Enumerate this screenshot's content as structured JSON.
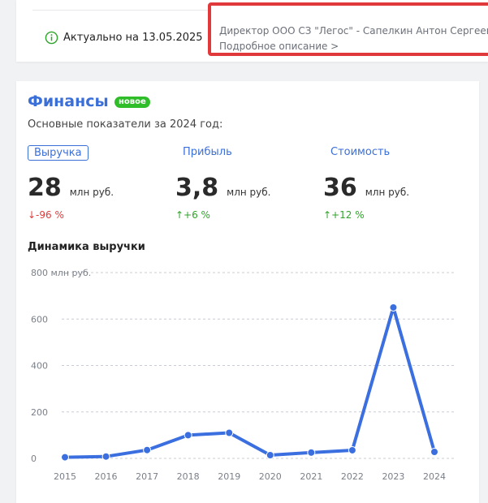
{
  "status": {
    "actual_label": "Актуально на 13.05.2025"
  },
  "director": {
    "text": "Директор ООО СЗ \"Легос\" - Сапелкин Антон Сергеевич (И",
    "link": "Подробное описание >"
  },
  "finance": {
    "title": "Финансы",
    "badge": "новое",
    "subtitle": "Основные показатели за 2024 год:",
    "metrics": [
      {
        "label": "Выручка",
        "value": "28",
        "unit": "млн руб.",
        "change": "↓-96 %",
        "direction": "down",
        "active": true
      },
      {
        "label": "Прибыль",
        "value": "3,8",
        "unit": "млн руб.",
        "change": "↑+6 %",
        "direction": "up",
        "active": false
      },
      {
        "label": "Стоимость",
        "value": "36",
        "unit": "млн руб.",
        "change": "↑+12 %",
        "direction": "up",
        "active": false
      }
    ],
    "chart_title": "Динамика выручки"
  },
  "colors": {
    "accent": "#3b6fd8",
    "line": "#3b6fe0",
    "down": "#e23b3b",
    "up": "#2fa52a",
    "highlight_border": "#e0383b",
    "badge": "#2fbd2a"
  },
  "chart_data": {
    "type": "line",
    "title": "Динамика выручки",
    "ylabel": "млн руб.",
    "y_tick_labels": [
      "0",
      "200",
      "400",
      "600",
      "800 млн руб."
    ],
    "y_ticks": [
      0,
      200,
      400,
      600,
      800
    ],
    "ylim": [
      0,
      800
    ],
    "x": [
      "2015",
      "2016",
      "2017",
      "2018",
      "2019",
      "2020",
      "2021",
      "2022",
      "2023",
      "2024"
    ],
    "series": [
      {
        "values": [
          5,
          8,
          36,
          100,
          110,
          14,
          25,
          35,
          650,
          28
        ]
      }
    ],
    "grid": true,
    "legend": "none"
  }
}
